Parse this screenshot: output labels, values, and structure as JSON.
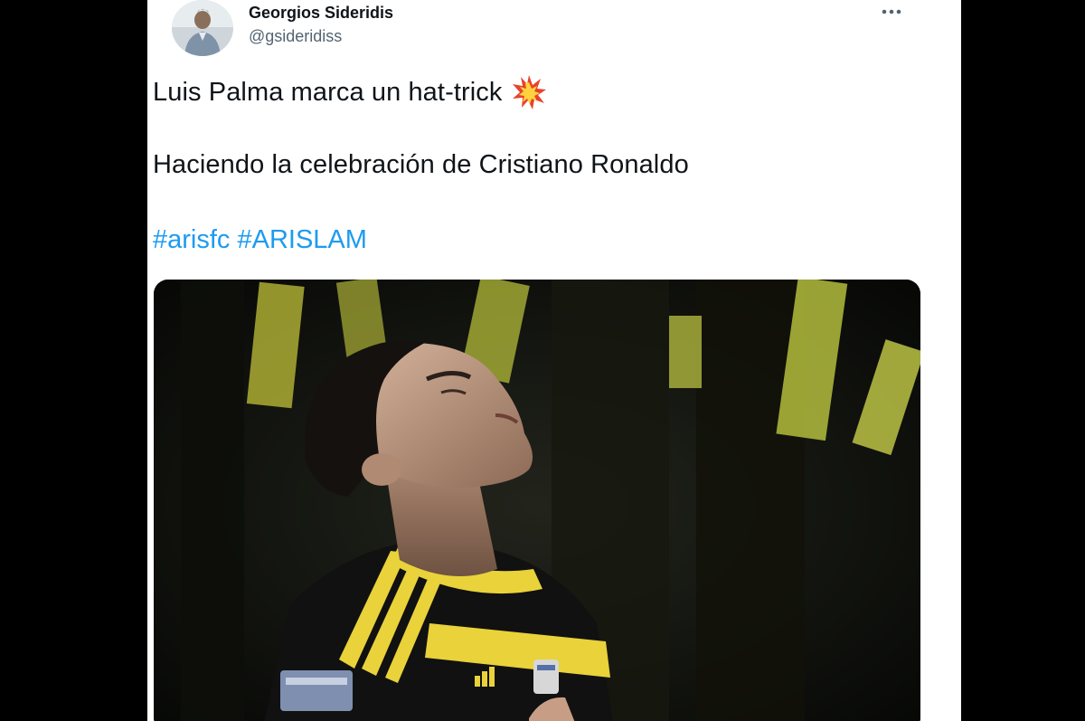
{
  "tweet": {
    "author": {
      "display_name": "Georgios Sideridis",
      "handle": "@gsideridiss",
      "avatar_icon": "user-avatar"
    },
    "more_icon": "more-horizontal-icon",
    "lines": [
      "Luis Palma marca un hat-trick",
      "Haciendo la celebración de Cristiano Ronaldo"
    ],
    "emoji_icon": "collision-emoji",
    "hashtags": [
      "#arisfc",
      "#ARISLAM"
    ],
    "media": {
      "kind": "photo",
      "subject": "footballer-celebrating-photo"
    }
  },
  "colors": {
    "background": "#000000",
    "card": "#ffffff",
    "text_primary": "#0f1419",
    "text_secondary": "#536471",
    "link": "#1d9bf0",
    "kit_yellow": "#e9d23a",
    "kit_black": "#111111"
  }
}
